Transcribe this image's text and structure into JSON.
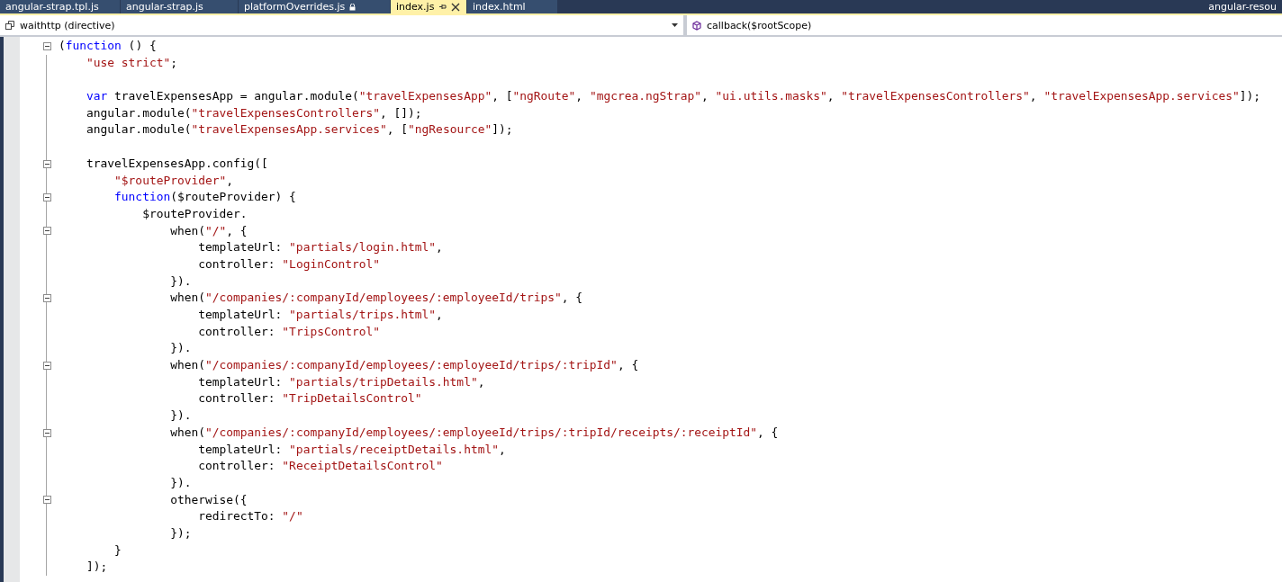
{
  "tabs": [
    {
      "label": "angular-strap.tpl.js",
      "selected": false,
      "locked": false
    },
    {
      "label": "angular-strap.js",
      "selected": false,
      "locked": false
    },
    {
      "label": "platformOverrides.js",
      "selected": false,
      "locked": true
    },
    {
      "label": "index.js",
      "selected": true,
      "locked": false
    },
    {
      "label": "index.html",
      "selected": false,
      "locked": false
    }
  ],
  "overflow_tab": "angular-resou",
  "nav": {
    "type_scope": "waithttp (directive)",
    "member": "callback($rootScope)"
  },
  "lines": [
    {
      "fold": true,
      "tokens": [
        {
          "kind": "plain",
          "text": "("
        },
        {
          "kind": "keyword",
          "text": "function"
        },
        {
          "kind": "plain",
          "text": " () {"
        }
      ]
    },
    {
      "fold": false,
      "tokens": [
        {
          "kind": "string",
          "text": "    \"use strict\""
        },
        {
          "kind": "plain",
          "text": ";"
        }
      ]
    },
    {
      "fold": false
    },
    {
      "fold": false,
      "tokens": [
        {
          "kind": "keyword",
          "text": "    var"
        },
        {
          "kind": "plain",
          "text": " travelExpensesApp = angular.module("
        },
        {
          "kind": "string",
          "text": "\"travelExpensesApp\""
        },
        {
          "kind": "plain",
          "text": ", ["
        },
        {
          "kind": "string",
          "text": "\"ngRoute\""
        },
        {
          "kind": "plain",
          "text": ", "
        },
        {
          "kind": "string",
          "text": "\"mgcrea.ngStrap\""
        },
        {
          "kind": "plain",
          "text": ", "
        },
        {
          "kind": "string",
          "text": "\"ui.utils.masks\""
        },
        {
          "kind": "plain",
          "text": ", "
        },
        {
          "kind": "string",
          "text": "\"travelExpensesControllers\""
        },
        {
          "kind": "plain",
          "text": ", "
        },
        {
          "kind": "string",
          "text": "\"travelExpensesApp.services\""
        },
        {
          "kind": "plain",
          "text": "]);"
        }
      ]
    },
    {
      "fold": false,
      "tokens": [
        {
          "kind": "plain",
          "text": "    angular.module("
        },
        {
          "kind": "string",
          "text": "\"travelExpensesControllers\""
        },
        {
          "kind": "plain",
          "text": ", []);"
        }
      ]
    },
    {
      "fold": false,
      "tokens": [
        {
          "kind": "plain",
          "text": "    angular.module("
        },
        {
          "kind": "string",
          "text": "\"travelExpensesApp.services\""
        },
        {
          "kind": "plain",
          "text": ", ["
        },
        {
          "kind": "string",
          "text": "\"ngResource\""
        },
        {
          "kind": "plain",
          "text": "]);"
        }
      ]
    },
    {
      "fold": false
    },
    {
      "fold": true,
      "tokens": [
        {
          "kind": "plain",
          "text": "    travelExpensesApp.config(["
        }
      ]
    },
    {
      "fold": false,
      "tokens": [
        {
          "kind": "string",
          "text": "        \"$routeProvider\""
        },
        {
          "kind": "plain",
          "text": ","
        }
      ]
    },
    {
      "fold": true,
      "tokens": [
        {
          "kind": "keyword",
          "text": "        function"
        },
        {
          "kind": "plain",
          "text": "($routeProvider) {"
        }
      ]
    },
    {
      "fold": false,
      "tokens": [
        {
          "kind": "plain",
          "text": "            $routeProvider."
        }
      ]
    },
    {
      "fold": true,
      "tokens": [
        {
          "kind": "plain",
          "text": "                when("
        },
        {
          "kind": "string",
          "text": "\"/\""
        },
        {
          "kind": "plain",
          "text": ", {"
        }
      ]
    },
    {
      "fold": false,
      "tokens": [
        {
          "kind": "plain",
          "text": "                    templateUrl: "
        },
        {
          "kind": "string",
          "text": "\"partials/login.html\""
        },
        {
          "kind": "plain",
          "text": ","
        }
      ]
    },
    {
      "fold": false,
      "tokens": [
        {
          "kind": "plain",
          "text": "                    controller: "
        },
        {
          "kind": "string",
          "text": "\"LoginControl\""
        }
      ]
    },
    {
      "fold": false,
      "tokens": [
        {
          "kind": "plain",
          "text": "                })."
        }
      ]
    },
    {
      "fold": true,
      "tokens": [
        {
          "kind": "plain",
          "text": "                when("
        },
        {
          "kind": "string",
          "text": "\"/companies/:companyId/employees/:employeeId/trips\""
        },
        {
          "kind": "plain",
          "text": ", {"
        }
      ]
    },
    {
      "fold": false,
      "tokens": [
        {
          "kind": "plain",
          "text": "                    templateUrl: "
        },
        {
          "kind": "string",
          "text": "\"partials/trips.html\""
        },
        {
          "kind": "plain",
          "text": ","
        }
      ]
    },
    {
      "fold": false,
      "tokens": [
        {
          "kind": "plain",
          "text": "                    controller: "
        },
        {
          "kind": "string",
          "text": "\"TripsControl\""
        }
      ]
    },
    {
      "fold": false,
      "tokens": [
        {
          "kind": "plain",
          "text": "                })."
        }
      ]
    },
    {
      "fold": true,
      "tokens": [
        {
          "kind": "plain",
          "text": "                when("
        },
        {
          "kind": "string",
          "text": "\"/companies/:companyId/employees/:employeeId/trips/:tripId\""
        },
        {
          "kind": "plain",
          "text": ", {"
        }
      ]
    },
    {
      "fold": false,
      "tokens": [
        {
          "kind": "plain",
          "text": "                    templateUrl: "
        },
        {
          "kind": "string",
          "text": "\"partials/tripDetails.html\""
        },
        {
          "kind": "plain",
          "text": ","
        }
      ]
    },
    {
      "fold": false,
      "tokens": [
        {
          "kind": "plain",
          "text": "                    controller: "
        },
        {
          "kind": "string",
          "text": "\"TripDetailsControl\""
        }
      ]
    },
    {
      "fold": false,
      "tokens": [
        {
          "kind": "plain",
          "text": "                })."
        }
      ]
    },
    {
      "fold": true,
      "tokens": [
        {
          "kind": "plain",
          "text": "                when("
        },
        {
          "kind": "string",
          "text": "\"/companies/:companyId/employees/:employeeId/trips/:tripId/receipts/:receiptId\""
        },
        {
          "kind": "plain",
          "text": ", {"
        }
      ]
    },
    {
      "fold": false,
      "tokens": [
        {
          "kind": "plain",
          "text": "                    templateUrl: "
        },
        {
          "kind": "string",
          "text": "\"partials/receiptDetails.html\""
        },
        {
          "kind": "plain",
          "text": ","
        }
      ]
    },
    {
      "fold": false,
      "tokens": [
        {
          "kind": "plain",
          "text": "                    controller: "
        },
        {
          "kind": "string",
          "text": "\"ReceiptDetailsControl\""
        }
      ]
    },
    {
      "fold": false,
      "tokens": [
        {
          "kind": "plain",
          "text": "                })."
        }
      ]
    },
    {
      "fold": true,
      "tokens": [
        {
          "kind": "plain",
          "text": "                otherwise({"
        }
      ]
    },
    {
      "fold": false,
      "tokens": [
        {
          "kind": "plain",
          "text": "                    redirectTo: "
        },
        {
          "kind": "string",
          "text": "\"/\""
        }
      ]
    },
    {
      "fold": false,
      "tokens": [
        {
          "kind": "plain",
          "text": "                });"
        }
      ]
    },
    {
      "fold": false,
      "tokens": [
        {
          "kind": "plain",
          "text": "        }"
        }
      ]
    },
    {
      "fold": false,
      "tokens": [
        {
          "kind": "plain",
          "text": "    ]);"
        }
      ]
    }
  ]
}
